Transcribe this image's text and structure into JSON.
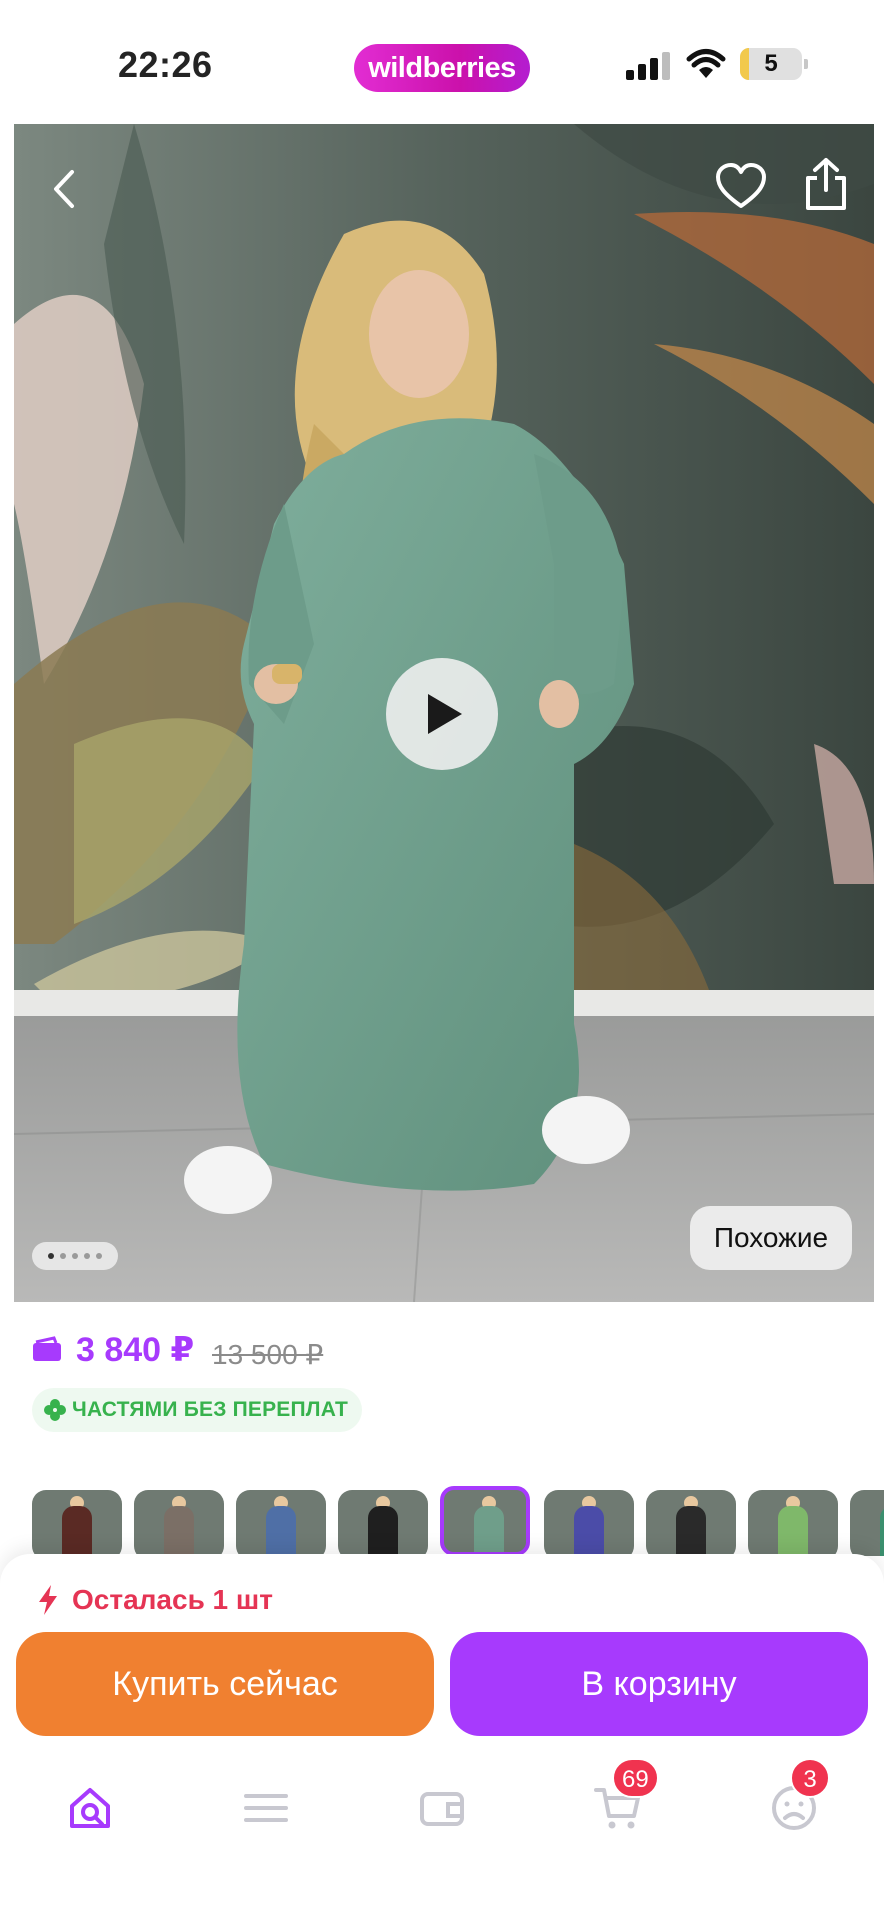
{
  "status_bar": {
    "time": "22:26",
    "brand": "wildberries",
    "battery_level": "5",
    "colors": {
      "brand_gradient_start": "#e22dd3",
      "brand_gradient_end": "#b41dd0"
    }
  },
  "product": {
    "media": {
      "icons": [
        "chevron-left-icon",
        "heart-icon",
        "share-icon",
        "play-icon"
      ],
      "pager_total": 5,
      "pager_active": 1,
      "similar_label": "Похожие"
    },
    "price": "3 840 ₽",
    "old_price": "13 500 ₽",
    "installment_label": "ЧАСТЯМИ БЕЗ ПЕРЕПЛАТ",
    "colors": {
      "accent": "#a73afd",
      "installment_green": "#37b24d"
    },
    "variants": [
      {
        "color": "#5a2a24"
      },
      {
        "color": "#7b6f66"
      },
      {
        "color": "#4f6fa6"
      },
      {
        "color": "#1f1f1f"
      },
      {
        "color": "#6f9e8a",
        "selected": true
      },
      {
        "color": "#4b4ca8"
      },
      {
        "color": "#2a2a2a"
      },
      {
        "color": "#7fb86a"
      },
      {
        "color": "#3b8f6e"
      }
    ]
  },
  "purchase": {
    "stock_label": "Осталась 1 шт",
    "buy_now_label": "Купить сейчас",
    "add_to_cart_label": "В корзину",
    "colors": {
      "buy_now": "#f08030",
      "cart": "#a73afd",
      "alert": "#e53454"
    }
  },
  "tab_bar": {
    "items": [
      {
        "name": "home-search-icon",
        "active": true
      },
      {
        "name": "catalog-menu-icon"
      },
      {
        "name": "wallet-icon"
      },
      {
        "name": "cart-icon",
        "badge": "69"
      },
      {
        "name": "profile-icon",
        "badge": "3"
      }
    ]
  }
}
